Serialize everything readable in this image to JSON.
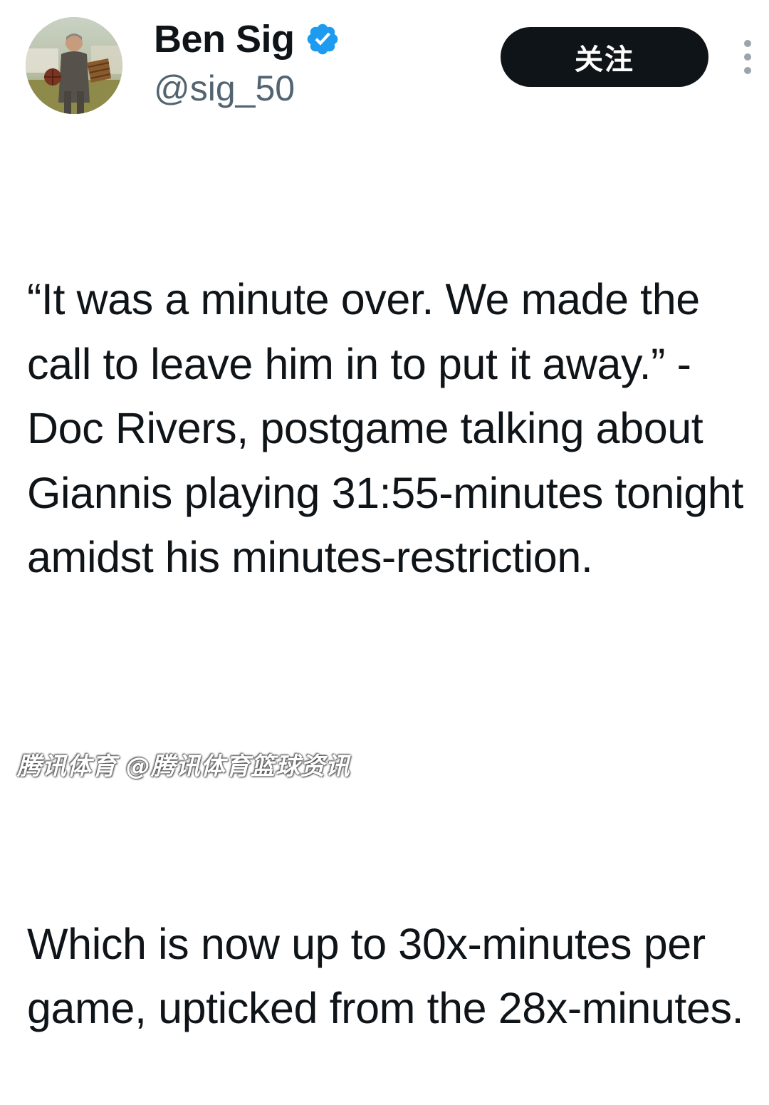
{
  "author": {
    "display_name": "Ben Sig",
    "handle": "@sig_50",
    "verified": true,
    "verified_color": "#1d9bf0",
    "avatar_icon": "vintage-photo-man-with-basketball-and-peach-basket"
  },
  "actions": {
    "follow_label": "关注",
    "more_icon": "more-vertical-icon"
  },
  "tweet": {
    "paragraphs": [
      "“It was a minute over. We made the call to leave him in to put it away.” -Doc Rivers, postgame talking about Giannis playing 31:55-minutes tonight amidst his minutes-restriction.",
      "Which is now up to 30x-minutes per game, upticked from the 28x-minutes."
    ]
  },
  "watermark": {
    "text": "腾讯体育 @腾讯体育篮球资讯"
  },
  "colors": {
    "text": "#0f1419",
    "secondary_text": "#536471",
    "button_bg": "#0f1419",
    "button_text": "#ffffff",
    "background": "#ffffff"
  }
}
